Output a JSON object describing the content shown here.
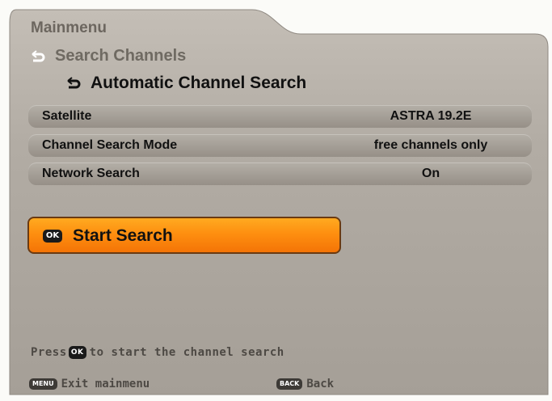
{
  "header": {
    "menu_title": "Mainmenu",
    "submenu_title": "Search Channels",
    "page_title": "Automatic Channel Search"
  },
  "settings": [
    {
      "label": "Satellite",
      "value": "ASTRA 19.2E"
    },
    {
      "label": "Channel Search Mode",
      "value": "free channels only"
    },
    {
      "label": "Network Search",
      "value": "On"
    }
  ],
  "action": {
    "key_label": "OK",
    "label": "Start Search"
  },
  "hint": {
    "prefix": "Press",
    "key_label": "OK",
    "suffix": "to start the channel search"
  },
  "footer": {
    "menu_key": "MENU",
    "menu_label": "Exit mainmenu",
    "back_key": "BACK",
    "back_label": "Back"
  },
  "colors": {
    "panel": "#aea79f",
    "row": "#a29c94",
    "button": "#fe8f10",
    "text_dim": "#6c665f"
  }
}
